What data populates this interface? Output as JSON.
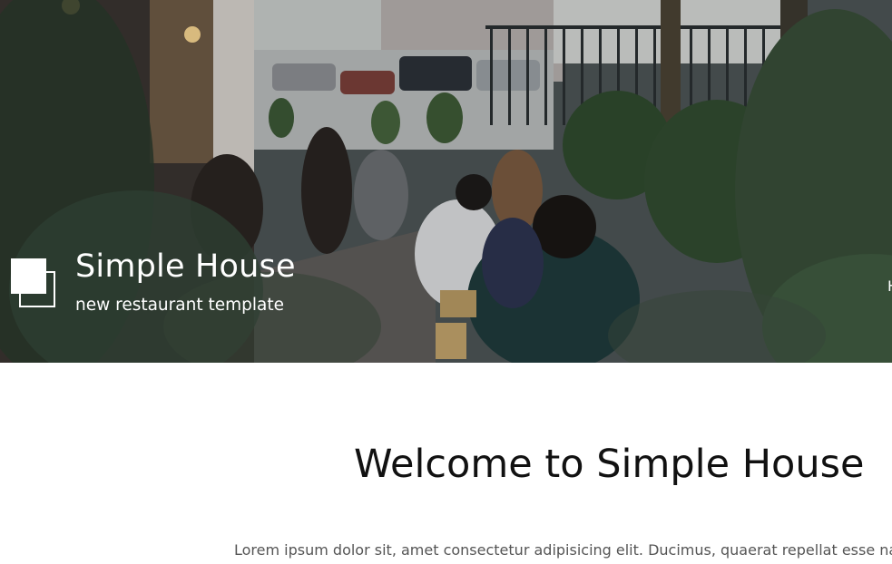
{
  "hero": {
    "site_title": "Simple House",
    "tagline": "new restaurant template",
    "nav_peek": "H"
  },
  "main": {
    "welcome_title": "Welcome to Simple House",
    "intro_text": "Lorem ipsum dolor sit, amet consectetur adipisicing elit. Ducimus, quaerat repellat esse natus L"
  },
  "colors": {
    "text_dark": "#111111",
    "text_body": "#555555",
    "hero_text": "#ffffff"
  }
}
